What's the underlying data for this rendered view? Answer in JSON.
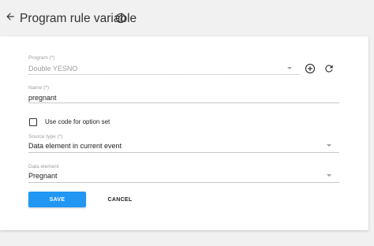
{
  "header": {
    "title": "Program rule variable",
    "back_icon": "arrow-back-icon",
    "help_icon": "help-circle-icon"
  },
  "form": {
    "program": {
      "label": "Program (*)",
      "value": "Double YESNO",
      "add_icon": "add-circle-icon",
      "refresh_icon": "refresh-icon"
    },
    "name": {
      "label": "Name (*)",
      "value": "pregnant"
    },
    "use_code_checkbox": {
      "label": "Use code for option set",
      "checked": false
    },
    "source_type": {
      "label": "Source type (*)",
      "value": "Data element in current event"
    },
    "data_element": {
      "label": "Data element",
      "value": "Pregnant"
    }
  },
  "actions": {
    "save_label": "SAVE",
    "cancel_label": "CANCEL"
  },
  "colors": {
    "accent": "#2196f3",
    "background": "#f1f1f1",
    "card": "#ffffff"
  }
}
